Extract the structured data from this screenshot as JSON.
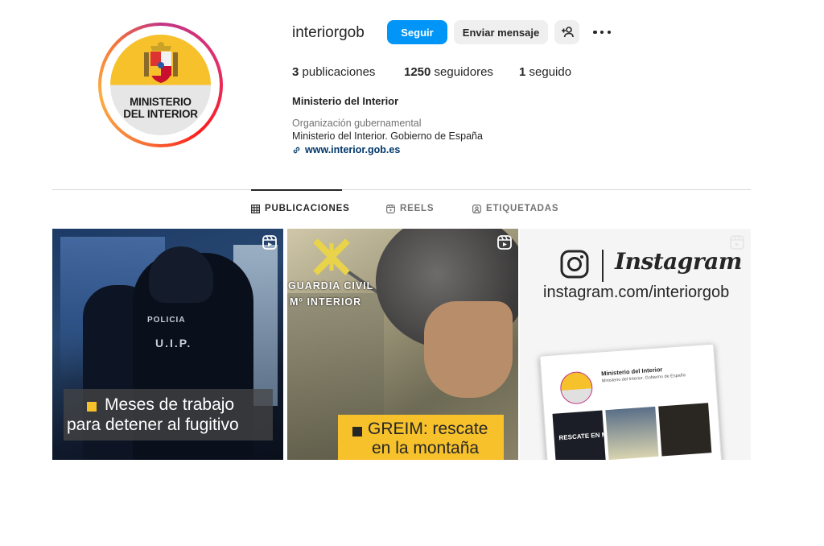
{
  "profile": {
    "username": "interiorgob",
    "avatar_line1": "MINISTERIO",
    "avatar_line2": "DEL INTERIOR",
    "follow_label": "Seguir",
    "message_label": "Enviar mensaje",
    "stats": {
      "posts_count": "3",
      "posts_label": "publicaciones",
      "followers_count": "1250",
      "followers_label": "seguidores",
      "following_count": "1",
      "following_label": "seguido"
    },
    "display_name": "Ministerio del Interior",
    "category": "Organización gubernamental",
    "bio": "Ministerio del Interior. Gobierno de España",
    "website": "www.interior.gob.es"
  },
  "tabs": [
    {
      "label": "PUBLICACIONES",
      "icon": "grid-icon",
      "active": true
    },
    {
      "label": "REELS",
      "icon": "reels-icon",
      "active": false
    },
    {
      "label": "ETIQUETADAS",
      "icon": "tagged-icon",
      "active": false
    }
  ],
  "posts": [
    {
      "type": "reel",
      "overlay_line1": "Meses de trabajo",
      "overlay_line2": "para detener al fugitivo",
      "vest_text1": "POLICIA",
      "vest_text2": "U.I.P."
    },
    {
      "type": "reel",
      "overlay_line1": "GREIM: rescate",
      "overlay_line2": "en la montaña",
      "badge_line1": "GUARDIA CIVIL",
      "badge_line2": "Mº INTERIOR"
    },
    {
      "type": "reel",
      "brand": "Instagram",
      "url": "instagram.com/interiorgob",
      "mock_name": "Ministerio del Interior",
      "mock_text": "Ministerio del Interior. Gobierno de España",
      "mock_thumb_text": "RESCATE EN MONTAÑA"
    }
  ],
  "colors": {
    "accent": "#0095f6",
    "brand_yellow": "#f6c12b",
    "link": "#00376b"
  }
}
